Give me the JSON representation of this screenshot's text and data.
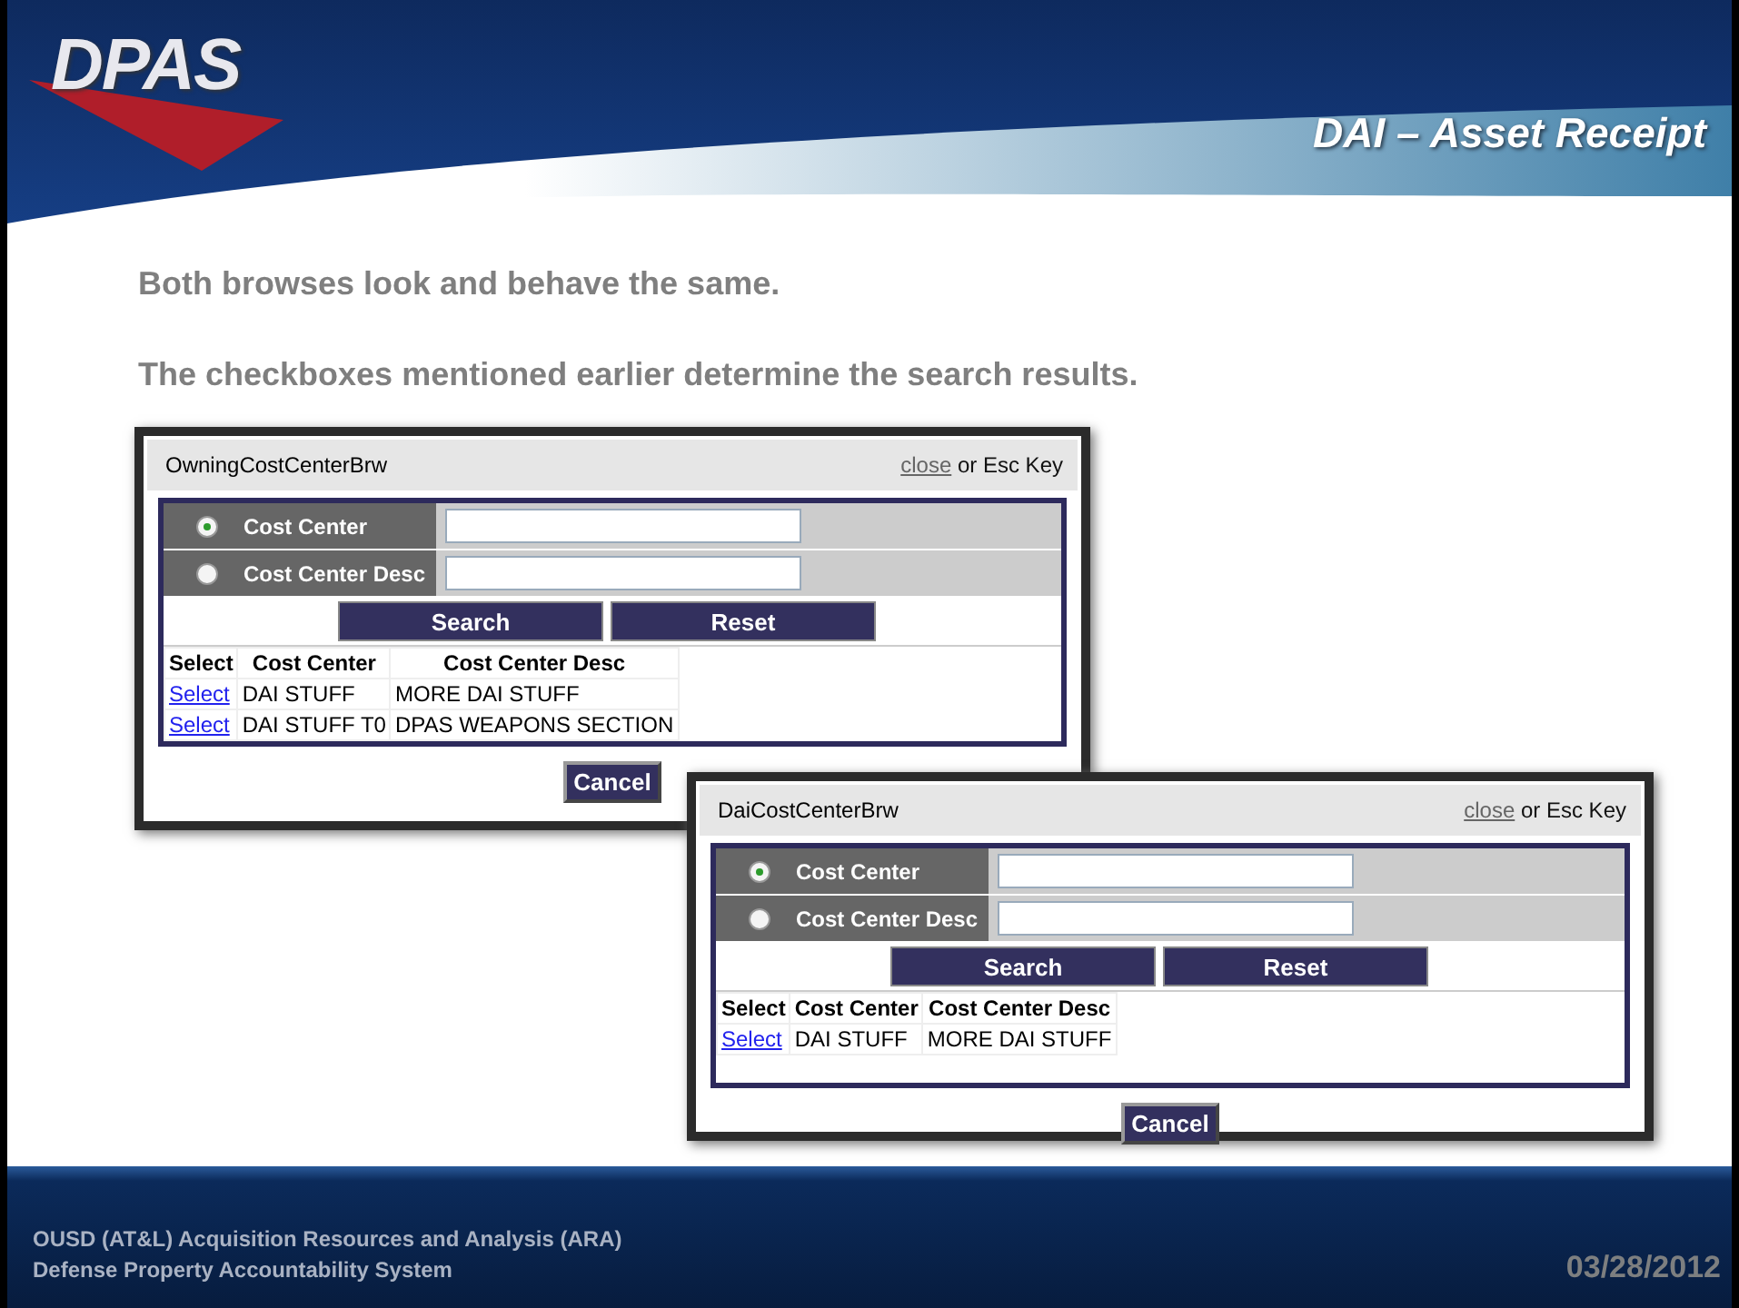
{
  "header": {
    "logo": "DPAS",
    "title": "DAI – Asset Receipt"
  },
  "bullets": [
    "Both browses look and behave the same.",
    "The checkboxes mentioned earlier determine the search results."
  ],
  "dialogs": [
    {
      "title": "OwningCostCenterBrw",
      "close_link": "close",
      "close_hint": "or Esc Key",
      "options": [
        {
          "label": "Cost Center",
          "selected": true
        },
        {
          "label": "Cost Center Desc",
          "selected": false
        }
      ],
      "buttons": [
        "Search",
        "Reset"
      ],
      "columns": [
        "Select",
        "Cost Center",
        "Cost Center Desc"
      ],
      "rows": [
        {
          "cells": [
            "Select",
            "DAI STUFF",
            "MORE DAI STUFF"
          ]
        },
        {
          "cells": [
            "Select",
            "DAI STUFF T0",
            "DPAS WEAPONS SECTION"
          ]
        }
      ],
      "cancel": "Cancel"
    },
    {
      "title": "DaiCostCenterBrw",
      "close_link": "close",
      "close_hint": "or Esc Key",
      "options": [
        {
          "label": "Cost Center",
          "selected": true
        },
        {
          "label": "Cost Center Desc",
          "selected": false
        }
      ],
      "buttons": [
        "Search",
        "Reset"
      ],
      "columns": [
        "Select",
        "Cost Center",
        "Cost Center Desc"
      ],
      "rows": [
        {
          "cells": [
            "Select",
            "DAI STUFF",
            "MORE DAI STUFF"
          ]
        }
      ],
      "cancel": "Cancel"
    }
  ],
  "footer": {
    "lines": [
      "OUSD (AT&L) Acquisition Resources and Analysis (ARA)",
      "Defense Property Accountability System"
    ],
    "date": "03/28/2012"
  }
}
